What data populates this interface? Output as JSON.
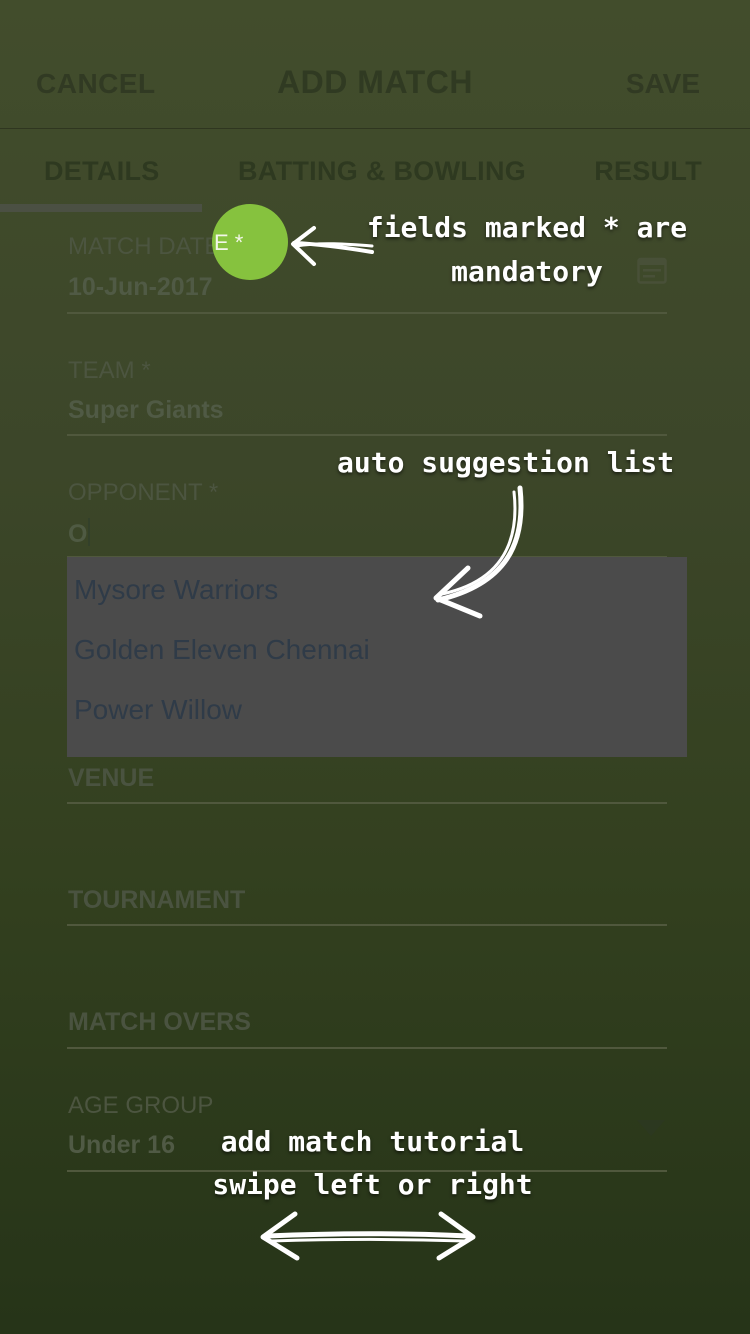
{
  "header": {
    "cancel_label": "CANCEL",
    "title": "ADD MATCH",
    "save_label": "SAVE"
  },
  "tabs": [
    {
      "label": "DETAILS",
      "active": true
    },
    {
      "label": "BATTING & BOWLING",
      "active": false
    },
    {
      "label": "RESULT",
      "active": false
    }
  ],
  "form": {
    "match_date": {
      "label": "MATCH DATE *",
      "value": "10-Jun-2017",
      "icon": "calendar-icon"
    },
    "team": {
      "label": "TEAM *",
      "value": "Super Giants"
    },
    "opponent": {
      "label": "OPPONENT *",
      "value": "O"
    },
    "suggestions": [
      "Mysore Warriors",
      "Golden Eleven Chennai",
      "Power Willow"
    ],
    "venue": {
      "label": "VENUE"
    },
    "tournament": {
      "label": "TOURNAMENT"
    },
    "match_overs": {
      "label": "MATCH OVERS"
    },
    "age_group": {
      "label": "AGE GROUP",
      "value": "Under 16",
      "icon": "dropdown-arrow-icon"
    }
  },
  "tutorial": {
    "highlight_text": "E *",
    "mandatory_note_line1": "fields marked * are",
    "mandatory_note_line2": "mandatory",
    "suggestion_note": "auto suggestion list",
    "swipe_note_line1": "add match tutorial",
    "swipe_note_line2": "swipe left or right"
  },
  "colors": {
    "overlay_tint": "#3c4629",
    "highlight": "#86c23e",
    "suggestion_bg": "#4b4b4b",
    "annotation_text": "#ffffff"
  }
}
